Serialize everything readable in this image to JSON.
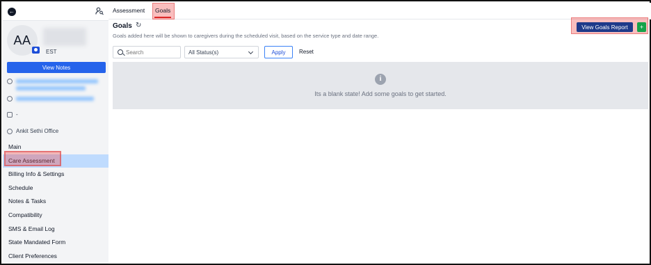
{
  "sidebar": {
    "back_icon": "arrow-left-icon",
    "search_user_icon": "user-search-icon",
    "avatar_initials": "AA",
    "timezone": "EST",
    "view_notes_label": "View Notes",
    "phone": "-",
    "office": "Ankit Sethi Office",
    "nav": [
      {
        "label": "Main"
      },
      {
        "label": "Care Assessment"
      },
      {
        "label": "Billing Info & Settings"
      },
      {
        "label": "Schedule"
      },
      {
        "label": "Notes & Tasks"
      },
      {
        "label": "Compatibility"
      },
      {
        "label": "SMS & Email Log"
      },
      {
        "label": "State Mandated Form"
      },
      {
        "label": "Client Preferences"
      }
    ]
  },
  "tabs": [
    {
      "label": "Assessment"
    },
    {
      "label": "Goals"
    }
  ],
  "goals": {
    "title": "Goals",
    "description": "Goals added here will be shown to caregivers during the scheduled visit, based on the service type and date range.",
    "view_report_label": "View Goals Report",
    "add_label": "+"
  },
  "filters": {
    "search_placeholder": "Search",
    "status_value": "All Status(s)",
    "apply_label": "Apply",
    "reset_label": "Reset"
  },
  "empty_state": {
    "icon": "info-icon",
    "icon_glyph": "i",
    "message": "Its a blank state! Add some goals to get started."
  },
  "colors": {
    "primary": "#2563eb",
    "report_button": "#1e3a8a",
    "add_button": "#16a34a",
    "active_nav": "#bfdbfe",
    "highlight": "#ef4444"
  }
}
